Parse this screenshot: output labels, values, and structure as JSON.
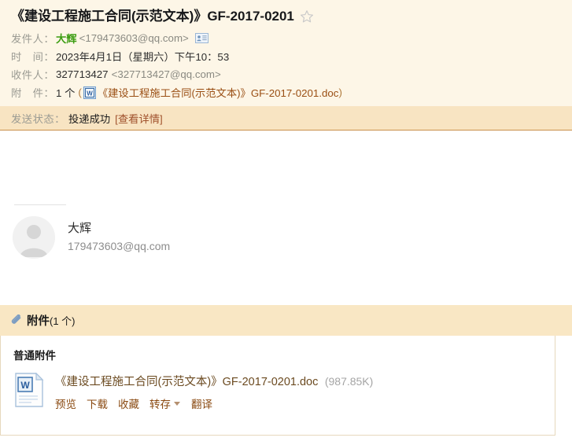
{
  "mail": {
    "subject": "《建设工程施工合同(示范文本)》GF-2017-0201",
    "star_icon": "star-outline-icon",
    "rows": {
      "sender_label": "发件人：",
      "sender_name": "大辉",
      "sender_address": "<179473603@qq.com>",
      "vcard_icon": "contact-card-icon",
      "time_label": "时　间：",
      "time_value": "2023年4月1日（星期六）下午10：53",
      "to_label": "收件人：",
      "to_name": "327713427",
      "to_address": "<327713427@qq.com>",
      "attach_label": "附　件：",
      "attach_count": "1 个",
      "attach_open_paren": "(",
      "attach_icon": "word-doc-icon",
      "attach_name": "《建设工程施工合同(示范文本)》GF-2017-0201.doc",
      "attach_close_paren": ")"
    },
    "status": {
      "label": "发送状态：",
      "value": "投递成功",
      "detail_link": "[查看详情]"
    },
    "signature": {
      "avatar_icon": "default-avatar-icon",
      "name": "大辉",
      "email": "179473603@qq.com"
    }
  },
  "attachments": {
    "panel_icon": "paperclip-icon",
    "panel_title": "附件",
    "panel_count": "(1 个)",
    "section_title": "普通附件",
    "items": [
      {
        "icon": "word-doc-icon",
        "name": "《建设工程施工合同(示范文本)》GF-2017-0201.doc",
        "size": "(987.85K)",
        "actions": {
          "preview": "预览",
          "download": "下载",
          "favorite": "收藏",
          "save_to": "转存",
          "translate": "翻译"
        }
      }
    ]
  },
  "colors": {
    "header_bg": "#fdf6e7",
    "status_bg": "#f8e4c2",
    "status_border": "#c9904a",
    "panel_head_bg": "#f9e7c4",
    "link_brown": "#8a4a12",
    "sender_green": "#3c9d12"
  }
}
